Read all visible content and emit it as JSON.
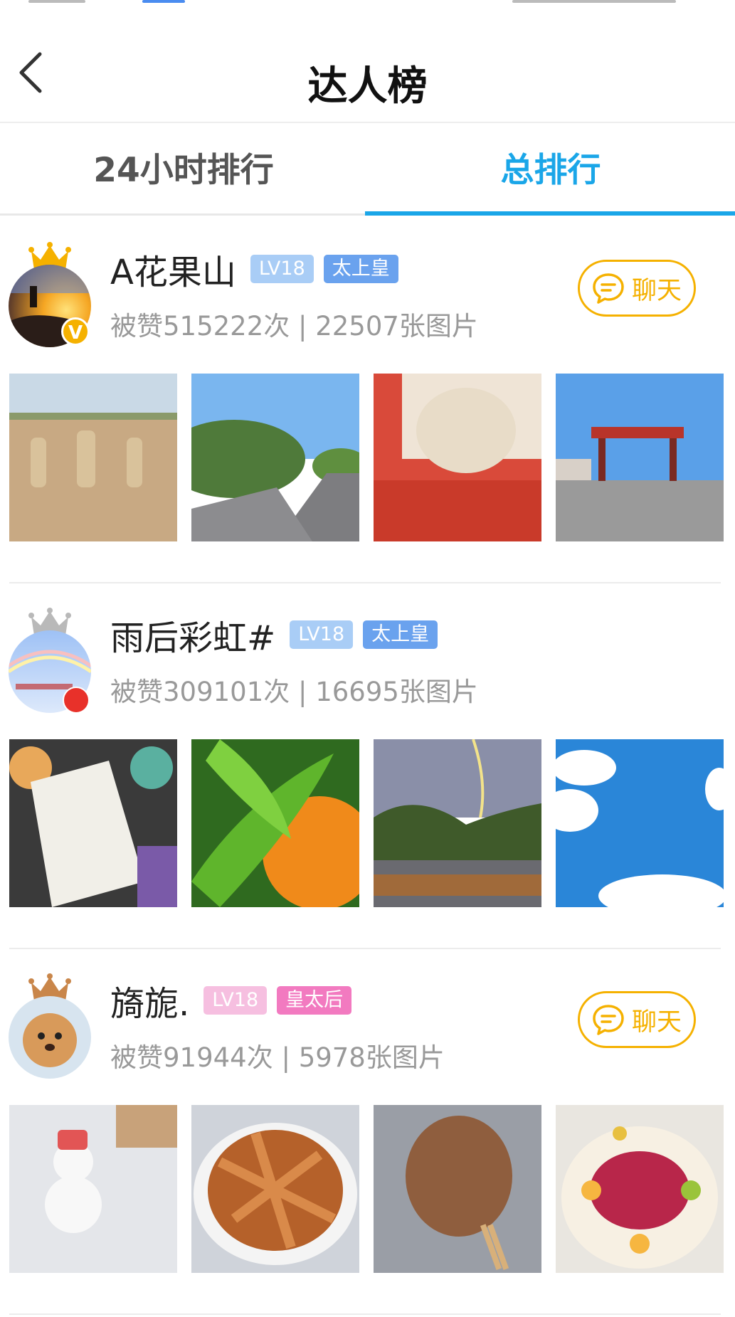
{
  "header": {
    "title": "达人榜"
  },
  "tabs": [
    {
      "label": "24小时排行",
      "active": false
    },
    {
      "label": "总排行",
      "active": true
    }
  ],
  "colors": {
    "accent": "#1aa6e8",
    "chat": "#f5b100",
    "gold_crown": "#f5b100",
    "silver_crown": "#b9b9b9",
    "bronze_crown": "#c9864a"
  },
  "users": [
    {
      "name": "A花果山",
      "level": "LV18",
      "rank": "太上皇",
      "stats": "被赞515222次 | 22507张图片",
      "chat_label": "聊天",
      "crown": "gold",
      "badge": "v"
    },
    {
      "name": "雨后彩虹#",
      "level": "LV18",
      "rank": "太上皇",
      "stats": "被赞309101次 | 16695张图片",
      "crown": "silver",
      "badge": "flag"
    },
    {
      "name": "旖旎.",
      "level": "LV18",
      "rank": "皇太后",
      "stats": "被赞91944次 | 5978张图片",
      "chat_label": "聊天",
      "crown": "bronze",
      "badge": "none"
    }
  ]
}
